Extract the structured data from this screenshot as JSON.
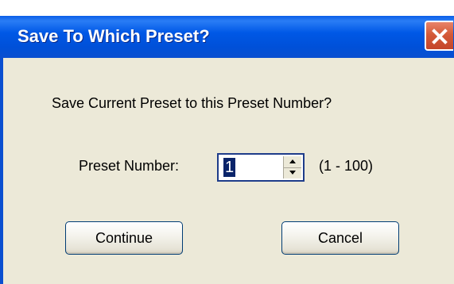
{
  "window": {
    "title": "Save To Which Preset?",
    "close_icon": "close-icon"
  },
  "message": "Save Current Preset to this Preset Number?",
  "preset": {
    "label": "Preset Number:",
    "value": "1",
    "range": "(1 - 100)"
  },
  "buttons": {
    "continue_label": "Continue",
    "cancel_label": "Cancel"
  },
  "colors": {
    "titlebar": "#0054e3",
    "close_button": "#d45a38",
    "dialog_background": "#ece9d8"
  }
}
